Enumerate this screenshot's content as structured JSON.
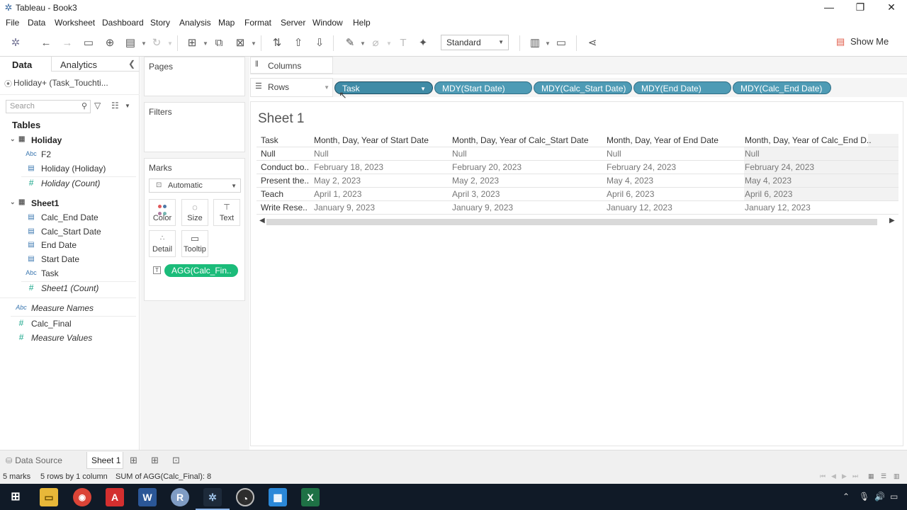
{
  "window": {
    "title": "Tableau - Book3",
    "controls": {
      "minimize": "—",
      "restore": "❐",
      "close": "✕"
    }
  },
  "menu": [
    "File",
    "Data",
    "Worksheet",
    "Dashboard",
    "Story",
    "Analysis",
    "Map",
    "Format",
    "Server",
    "Window",
    "Help"
  ],
  "toolbar": {
    "fit_value": "Standard",
    "show_me_label": "Show Me",
    "icons": [
      "tableau-logo-icon",
      "undo-icon",
      "redo-icon",
      "save-icon",
      "new-datasource-icon",
      "pause-updates-icon",
      "refresh-icon",
      "new-worksheet-icon",
      "duplicate-icon",
      "clear-sheet-icon",
      "swap-icon",
      "sort-ascending-icon",
      "sort-descending-icon",
      "highlight-icon",
      "group-icon",
      "labels-icon",
      "pin-icon",
      "presentation-icon",
      "share-icon"
    ]
  },
  "data_pane": {
    "tab_data": "Data",
    "tab_analytics": "Analytics",
    "datasource": "Holiday+ (Task_Touchti...",
    "search_placeholder": "Search",
    "tables_heading": "Tables",
    "tables": [
      {
        "name": "Holiday",
        "fields": [
          {
            "type": "Abc",
            "name": "F2"
          },
          {
            "type": "date",
            "name": "Holiday (Holiday)"
          },
          {
            "type": "#",
            "name": "Holiday (Count)",
            "italic": true
          }
        ]
      },
      {
        "name": "Sheet1",
        "fields": [
          {
            "type": "calc-date",
            "name": "Calc_End Date"
          },
          {
            "type": "calc-date",
            "name": "Calc_Start Date"
          },
          {
            "type": "date",
            "name": "End Date"
          },
          {
            "type": "date",
            "name": "Start Date"
          },
          {
            "type": "Abc",
            "name": "Task"
          },
          {
            "type": "#",
            "name": "Sheet1 (Count)",
            "italic": true
          }
        ]
      }
    ],
    "extra_fields": [
      {
        "type": "Abc",
        "name": "Measure Names",
        "italic": true
      },
      {
        "type": "#",
        "name": "Calc_Final"
      },
      {
        "type": "#",
        "name": "Measure Values",
        "italic": true
      }
    ]
  },
  "cards": {
    "pages": "Pages",
    "filters": "Filters",
    "marks": "Marks",
    "mark_type": "Automatic",
    "mark_buttons": [
      "Color",
      "Size",
      "Text",
      "Detail",
      "Tooltip"
    ],
    "mark_pill": "AGG(Calc_Fin.."
  },
  "shelves": {
    "columns_label": "Columns",
    "rows_label": "Rows",
    "row_pills": [
      "Task",
      "MDY(Start Date)",
      "MDY(Calc_Start Date)",
      "MDY(End Date)",
      "MDY(Calc_End Date)"
    ]
  },
  "sheet": {
    "title": "Sheet 1",
    "headers": [
      "Task",
      "Month, Day, Year of Start Date",
      "Month, Day, Year of Calc_Start Date",
      "Month, Day, Year of End Date",
      "Month, Day, Year of Calc_End D.."
    ],
    "rows": [
      [
        "Null",
        "Null",
        "Null",
        "Null",
        "Null"
      ],
      [
        "Conduct bo..",
        "February 18, 2023",
        "February 20, 2023",
        "February 24, 2023",
        "February 24, 2023"
      ],
      [
        "Present the..",
        "May 2, 2023",
        "May 2, 2023",
        "May 4, 2023",
        "May 4, 2023"
      ],
      [
        "Teach",
        "April 1, 2023",
        "April 3, 2023",
        "April 6, 2023",
        "April 6, 2023"
      ],
      [
        "Write Rese..",
        "January 9, 2023",
        "January 9, 2023",
        "January 12, 2023",
        "January 12, 2023"
      ]
    ]
  },
  "bottom": {
    "data_source_tab": "Data Source",
    "sheet_tab": "Sheet 1",
    "status": [
      "5 marks",
      "5 rows by 1 column",
      "SUM of AGG(Calc_Final): 8"
    ]
  },
  "taskbar": {
    "apps": [
      "windows-start-icon",
      "file-explorer-icon",
      "chrome-icon",
      "acrobat-icon",
      "word-icon",
      "r-icon",
      "tableau-icon",
      "obs-icon",
      "calendar-icon",
      "excel-icon"
    ]
  }
}
